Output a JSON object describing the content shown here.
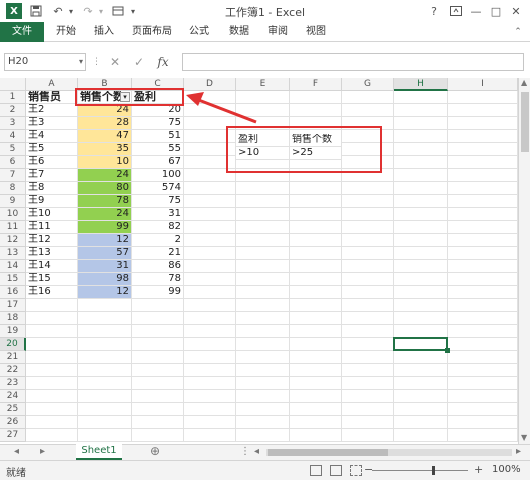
{
  "window": {
    "title": "工作簿1 - Excel",
    "help": "?",
    "minimize": "—",
    "maximize": "□",
    "close": "✕"
  },
  "ribbon_tabs": [
    "文件",
    "开始",
    "插入",
    "页面布局",
    "公式",
    "数据",
    "审阅",
    "视图"
  ],
  "formula_bar": {
    "name_box": "H20",
    "fx": "fx",
    "formula": ""
  },
  "grid": {
    "columns": [
      "A",
      "B",
      "C",
      "D",
      "E",
      "F",
      "G",
      "H",
      "I"
    ],
    "selected_column": "H",
    "selected_row": 20,
    "row_count": 27,
    "headers": [
      "销售员",
      "销售个数",
      "盈利"
    ],
    "rows": [
      [
        "王2",
        "24",
        "20"
      ],
      [
        "王3",
        "28",
        "75"
      ],
      [
        "王4",
        "47",
        "51"
      ],
      [
        "王5",
        "35",
        "55"
      ],
      [
        "王6",
        "10",
        "67"
      ],
      [
        "王7",
        "24",
        "100"
      ],
      [
        "王8",
        "80",
        "574"
      ],
      [
        "王9",
        "78",
        "75"
      ],
      [
        "王10",
        "24",
        "31"
      ],
      [
        "王11",
        "99",
        "82"
      ],
      [
        "王12",
        "12",
        "2"
      ],
      [
        "王13",
        "57",
        "21"
      ],
      [
        "王14",
        "31",
        "86"
      ],
      [
        "王15",
        "98",
        "78"
      ],
      [
        "王16",
        "12",
        "99"
      ]
    ],
    "criteria": {
      "header1": "盈利",
      "header2": "销售个数",
      "value1": ">10",
      "value2": ">25"
    },
    "colors": {
      "yellow": "#ffe699",
      "green": "#92d050",
      "blue": "#b4c6e7",
      "annotation": "#e03131"
    }
  },
  "sheet_bar": {
    "active_sheet": "Sheet1",
    "add_sheet": "⊕"
  },
  "status_bar": {
    "status": "就绪",
    "zoom": "100%",
    "zoom_out": "−",
    "zoom_in": "+"
  }
}
